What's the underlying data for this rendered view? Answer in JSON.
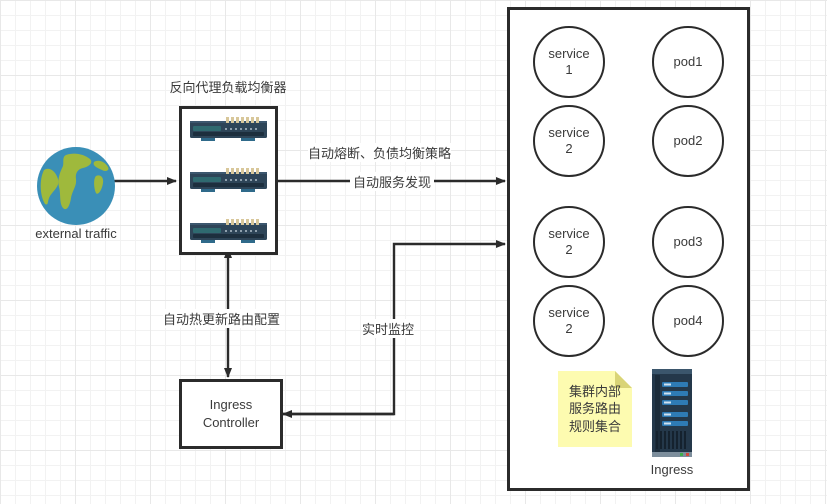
{
  "diagram": {
    "title_hidden": "",
    "external": {
      "icon": "globe-icon",
      "label": "external traffic"
    },
    "load_balancer": {
      "title": "反向代理负载均衡器",
      "device_icon": "network-switch-icon",
      "device_count": 3
    },
    "edges": [
      {
        "id": "edge-external-to-lb",
        "label": ""
      },
      {
        "id": "edge-lb-to-cluster-policy",
        "label": "自动熔断、负债均衡策略"
      },
      {
        "id": "edge-lb-to-cluster-discovery",
        "label": "自动服务发现"
      },
      {
        "id": "edge-lb-ingress-route",
        "label": "自动热更新路由配置"
      },
      {
        "id": "edge-ingress-to-cluster-monitor",
        "label": "实时监控"
      }
    ],
    "ingress_controller": {
      "line1": "Ingress",
      "line2": "Controller"
    },
    "cluster": {
      "pairs": [
        {
          "service": "service\n1",
          "service_line1": "service",
          "service_line2": "1",
          "pod": "pod1"
        },
        {
          "service": "service\n2",
          "service_line1": "service",
          "service_line2": "2",
          "pod": "pod2"
        },
        {
          "service": "service\n2",
          "service_line1": "service",
          "service_line2": "2",
          "pod": "pod3"
        },
        {
          "service": "service\n2",
          "service_line1": "service",
          "service_line2": "2",
          "pod": "pod4"
        }
      ],
      "note": {
        "line1": "集群内部",
        "line2": "服务路由",
        "line3": "规则集合",
        "color": "#fdfbb0",
        "fold_color": "#d9d477"
      },
      "ingress_device": {
        "icon": "server-tower-icon",
        "label": "Ingress"
      }
    },
    "colors": {
      "stroke": "#2b2b2b",
      "text": "#3a3a3a",
      "grid_minor": "#f2f2f2",
      "grid_major": "#e8e8e8",
      "globe_ocean": "#3a8fb7",
      "globe_land": "#9fb93c",
      "switch_body": "#2e4558",
      "switch_port": "#d8c79a",
      "server_body": "#24384a",
      "server_bar": "#2e7bb5"
    }
  }
}
